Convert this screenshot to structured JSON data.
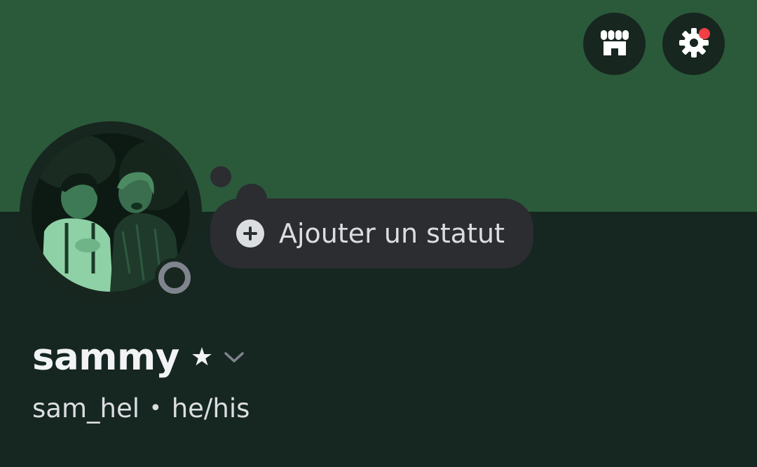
{
  "header": {
    "shop_icon": "shop-icon",
    "settings_icon": "gear-icon",
    "settings_notification": true
  },
  "profile": {
    "avatar_alt": "avatar",
    "presence": "offline",
    "status_button": {
      "icon": "plus-circle-icon",
      "label": "Ajouter un statut"
    },
    "display_name": "sammy",
    "badge": "★",
    "username": "sam_hel",
    "separator": "•",
    "pronouns": "he/his"
  },
  "colors": {
    "banner": "#2b5a3b",
    "background": "#162620",
    "pill": "#2b2d31",
    "notification": "#f23f43",
    "presence_offline": "#80848e"
  }
}
